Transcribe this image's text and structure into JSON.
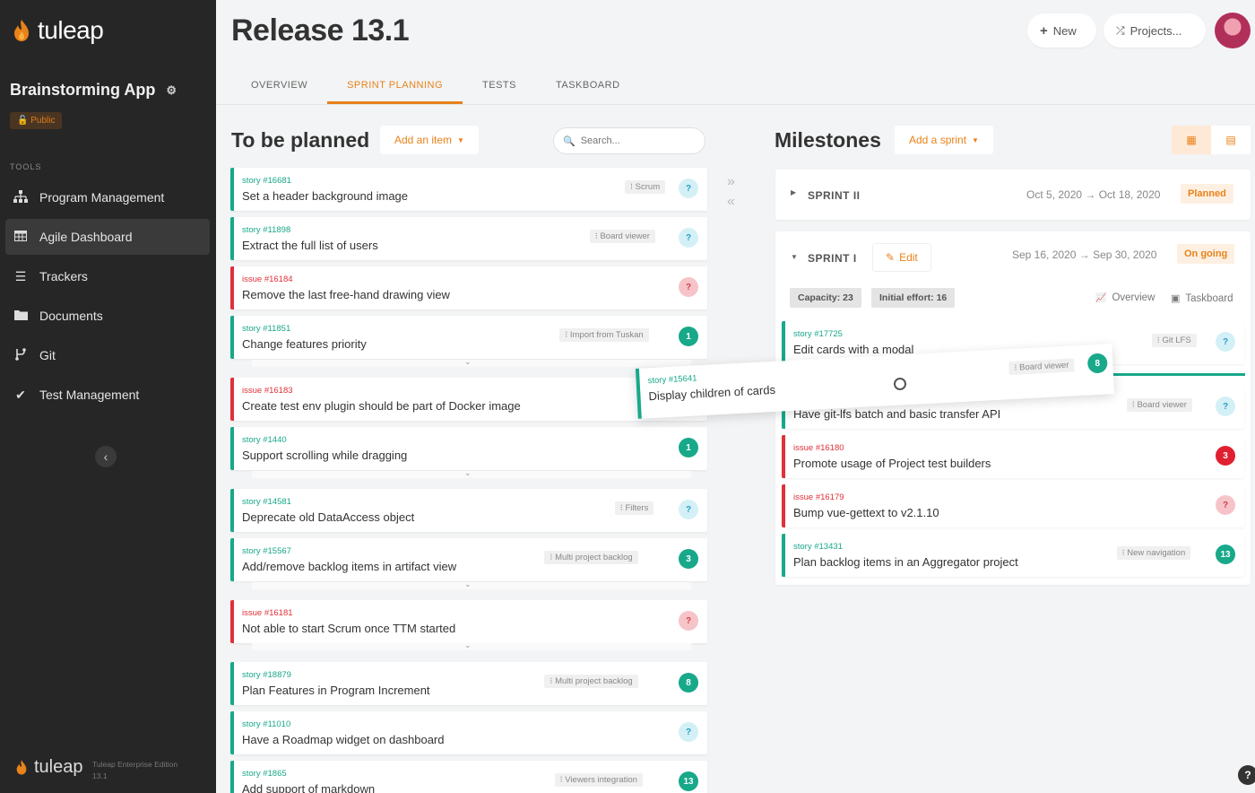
{
  "sidebar": {
    "logo_text": "tuleap",
    "project_name": "Brainstorming App",
    "visibility": "Public",
    "tools_label": "TOOLS",
    "items": [
      {
        "label": "Program Management",
        "icon": "sitemap-icon"
      },
      {
        "label": "Agile Dashboard",
        "icon": "table-icon"
      },
      {
        "label": "Trackers",
        "icon": "list-icon"
      },
      {
        "label": "Documents",
        "icon": "folder-icon"
      },
      {
        "label": "Git",
        "icon": "git-icon"
      },
      {
        "label": "Test Management",
        "icon": "check-icon"
      }
    ],
    "footer_logo": "tuleap",
    "edition": "Tuleap Enterprise Edition",
    "version": "13.1"
  },
  "header": {
    "title": "Release 13.1",
    "new_label": "New",
    "projects_label": "Projects..."
  },
  "tabs": [
    "OVERVIEW",
    "SPRINT PLANNING",
    "TESTS",
    "TASKBOARD"
  ],
  "backlog": {
    "title": "To be planned",
    "add_label": "Add an item",
    "search_placeholder": "Search...",
    "items": [
      {
        "type": "story",
        "id": "story #16681",
        "title": "Set a header background image",
        "tag": "Scrum",
        "badge": "?"
      },
      {
        "type": "story",
        "id": "story #11898",
        "title": "Extract the full list of users",
        "tag": "Board viewer",
        "badge": "?"
      },
      {
        "type": "issue",
        "id": "issue #16184",
        "title": "Remove the last free-hand drawing view",
        "tag": "",
        "badge": "?"
      },
      {
        "type": "story",
        "id": "story #11851",
        "title": "Change features priority",
        "tag": "Import from Tuskan",
        "badge": "1"
      },
      {
        "type": "issue",
        "id": "issue #16183",
        "title": "Create test env plugin should be part of Docker image",
        "tag": "",
        "badge": ""
      },
      {
        "type": "story",
        "id": "story #1440",
        "title": "Support scrolling while dragging",
        "tag": "",
        "badge": "1"
      },
      {
        "type": "story",
        "id": "story #14581",
        "title": "Deprecate old DataAccess object",
        "tag": "Filters",
        "badge": "?"
      },
      {
        "type": "story",
        "id": "story #15567",
        "title": "Add/remove backlog items in artifact view",
        "tag": "Multi project backlog",
        "badge": "3"
      },
      {
        "type": "issue",
        "id": "issue #16181",
        "title": "Not able to start Scrum once TTM started",
        "tag": "",
        "badge": "?"
      },
      {
        "type": "story",
        "id": "story #18879",
        "title": "Plan Features in Program Increment",
        "tag": "Multi project backlog",
        "badge": "8"
      },
      {
        "type": "story",
        "id": "story #11010",
        "title": "Have a Roadmap widget on dashboard",
        "tag": "",
        "badge": "?"
      },
      {
        "type": "story",
        "id": "story #1865",
        "title": "Add support of markdown",
        "tag": "Viewers integration",
        "badge": "13"
      }
    ]
  },
  "milestones": {
    "title": "Milestones",
    "add_label": "Add a sprint",
    "sprint2": {
      "name": "SPRINT II",
      "dates": "Oct 5, 2020 → Oct 18, 2020",
      "status": "Planned"
    },
    "sprint1": {
      "name": "SPRINT I",
      "edit_label": "Edit",
      "dates": "Sep 16, 2020 → Sep 30, 2020",
      "status": "On going",
      "capacity": "Capacity: 23",
      "initial_effort": "Initial effort: 16",
      "overview_label": "Overview",
      "taskboard_label": "Taskboard",
      "items": [
        {
          "type": "story",
          "id": "story #17725",
          "title": "Edit cards with a modal",
          "tag": "Git LFS",
          "badge": "?"
        },
        {
          "type": "story",
          "id": "",
          "title": "Have git-lfs batch and basic transfer API",
          "tag": "Board viewer",
          "badge": "?"
        },
        {
          "type": "issue",
          "id": "issue #16180",
          "title": "Promote usage of Project test builders",
          "tag": "",
          "badge": "3"
        },
        {
          "type": "issue",
          "id": "issue #16179",
          "title": "Bump vue-gettext to v2.1.10",
          "tag": "",
          "badge": "?"
        },
        {
          "type": "story",
          "id": "story #13431",
          "title": "Plan backlog items in an Aggregator project",
          "tag": "New navigation",
          "badge": "13"
        }
      ]
    }
  },
  "dragged": {
    "id": "story #15641",
    "title": "Display children of cards",
    "tag": "Board viewer",
    "badge": "8"
  },
  "colors": {
    "accent": "#e8821a",
    "story": "#18a88a",
    "issue": "#e0303a",
    "sidebar": "#262626"
  }
}
